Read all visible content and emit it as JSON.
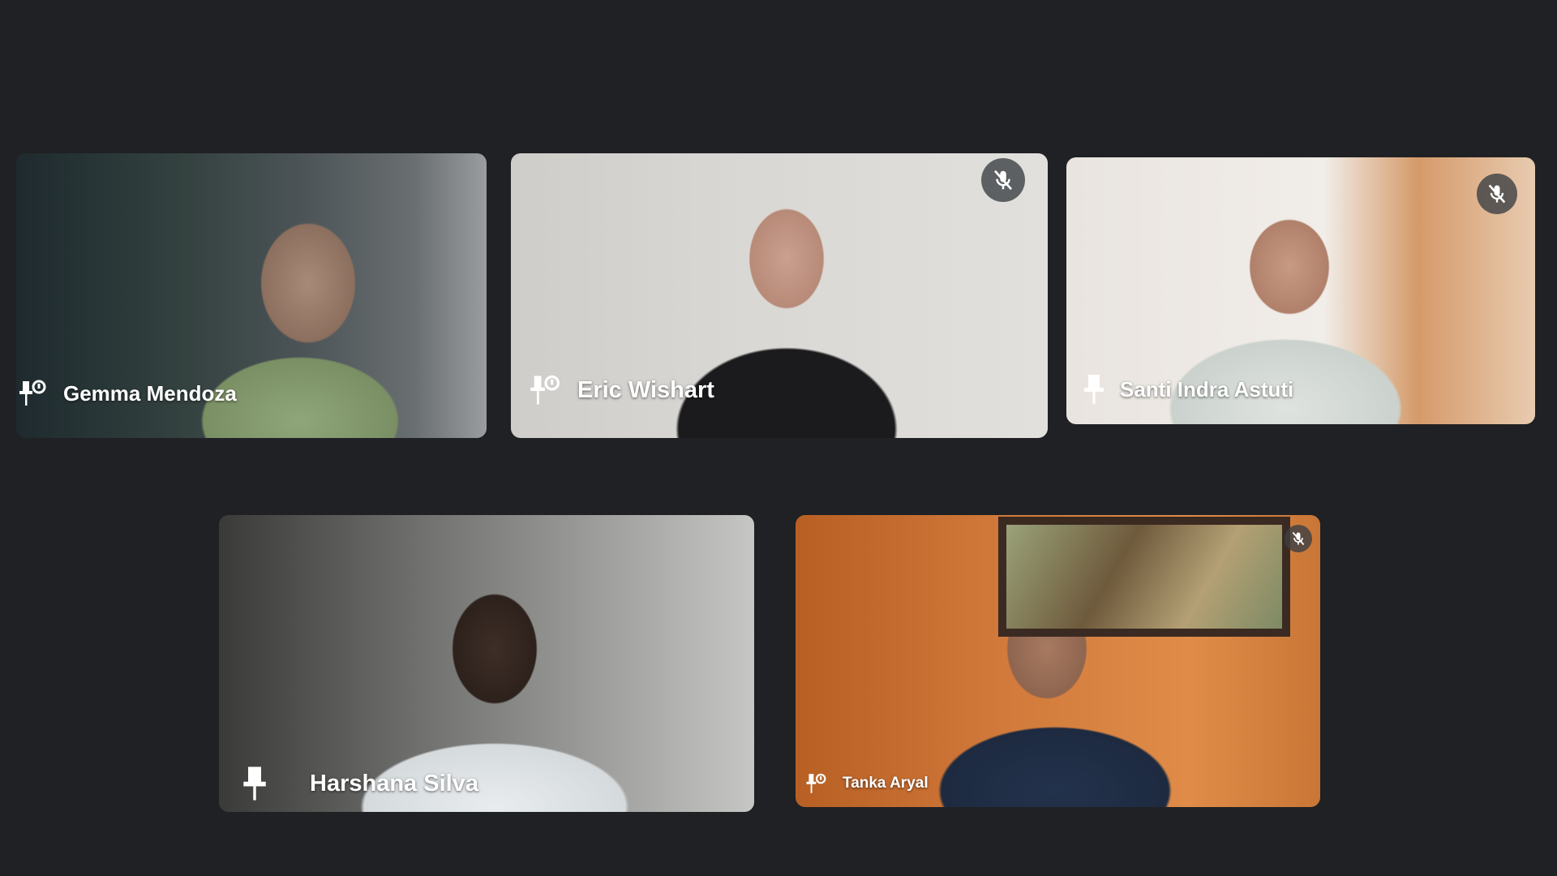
{
  "participants": [
    {
      "name": "Gemma Mendoza",
      "pin_icon": "pin-person-icon",
      "muted": false
    },
    {
      "name": "Eric Wishart",
      "pin_icon": "pin-person-icon",
      "muted": true,
      "mic_icon": "mic-off-icon"
    },
    {
      "name": "Santi Indra Astuti",
      "pin_icon": "pin-icon",
      "muted": true,
      "mic_icon": "mic-off-icon"
    },
    {
      "name": "Harshana Silva",
      "pin_icon": "pin-icon",
      "muted": false
    },
    {
      "name": "Tanka Aryal",
      "pin_icon": "pin-person-icon",
      "muted": true,
      "mic_icon": "mic-off-icon"
    }
  ],
  "colors": {
    "background": "#202124",
    "tile_fallback": "#3c4043",
    "name_text": "#ffffff"
  }
}
